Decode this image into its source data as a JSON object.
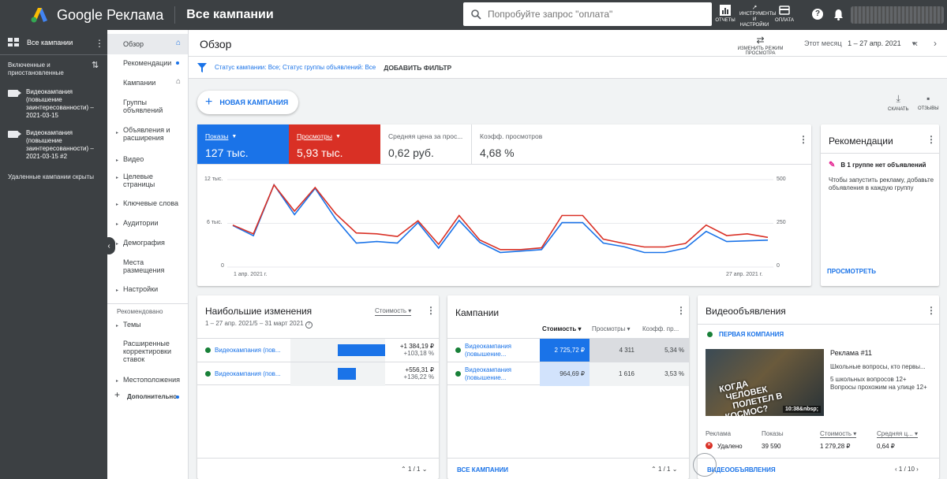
{
  "topbar": {
    "brand": "Google Реклама",
    "crumb": "Все кампании",
    "search_placeholder": "Попробуйте запрос \"оплата\"",
    "reports_label": "ОТЧЕТЫ",
    "tools_label": "ИНСТРУМЕНТЫ И НАСТРОЙКИ",
    "billing_label": "ОПЛАТА"
  },
  "camppanel": {
    "all_campaigns": "Все кампании",
    "filter_label": "Включенные и приостановленные",
    "campaigns": [
      {
        "name": "Видеокампания (повышение заинтересованности) – 2021-03-15"
      },
      {
        "name": "Видеокампания (повышение заинтересованности) – 2021-03-15 #2"
      }
    ],
    "hidden_label": "Удаленные кампании скрыты"
  },
  "nav": {
    "items": [
      {
        "label": "Обзор"
      },
      {
        "label": "Рекомендации"
      },
      {
        "label": "Кампании"
      },
      {
        "label": "Группы объявлений"
      },
      {
        "label": "Объявления и расширения"
      },
      {
        "label": "Видео"
      },
      {
        "label": "Целевые страницы"
      },
      {
        "label": "Ключевые слова"
      },
      {
        "label": "Аудитории"
      },
      {
        "label": "Демография"
      },
      {
        "label": "Места размещения"
      },
      {
        "label": "Настройки"
      },
      {
        "label": "Темы"
      },
      {
        "label": "Расширенные корректировки ставок"
      },
      {
        "label": "Местоположения"
      },
      {
        "label": "Дополнительно"
      }
    ],
    "recommended_section": "Рекомендовано"
  },
  "main": {
    "title": "Обзор",
    "view_mode": "ИЗМЕНИТЬ РЕЖИМ ПРОСМОТРА",
    "period_label": "Этот месяц",
    "period_value": "1 – 27 апр. 2021",
    "filter_prefix": "Статус кампании: ",
    "filter_val1": "Все",
    "filter_mid": "; Статус группы объявлений: ",
    "filter_val2": "Все",
    "add_filter": "ДОБАВИТЬ ФИЛЬТР",
    "new_campaign": "НОВАЯ КАМПАНИЯ",
    "download": "СКАЧАТЬ",
    "feedback": "ОТЗЫВЫ"
  },
  "metrics": [
    {
      "label": "Показы",
      "value": "127 тыс."
    },
    {
      "label": "Просмотры",
      "value": "5,93 тыс."
    },
    {
      "label": "Средняя цена за прос...",
      "value": "0,62 руб."
    },
    {
      "label": "Коэфф. просмотров",
      "value": "4,68 %"
    }
  ],
  "colors": {
    "impressions": "#1a73e8",
    "views": "#d93025"
  },
  "chart_data": {
    "type": "line",
    "x_labels": [
      "1 апр. 2021 г.",
      "27 апр. 2021 г."
    ],
    "left_axis_ticks": [
      "12 тыс.",
      "6 тыс.",
      "0"
    ],
    "right_axis_ticks": [
      "500",
      "250",
      "0"
    ],
    "ylim_left": [
      0,
      12000
    ],
    "ylim_right": [
      0,
      500
    ],
    "series": [
      {
        "name": "Показы",
        "axis": "left",
        "color": "#1a73e8",
        "values": [
          5700,
          4300,
          11300,
          7200,
          10800,
          6600,
          3300,
          3500,
          3300,
          6100,
          2600,
          6400,
          3400,
          2000,
          2200,
          2400,
          6100,
          6100,
          3300,
          2800,
          2000,
          2000,
          2600,
          4900,
          3500,
          3600,
          3700
        ]
      },
      {
        "name": "Просмотры",
        "axis": "right",
        "color": "#d93025",
        "values": [
          240,
          190,
          470,
          320,
          455,
          305,
          195,
          190,
          175,
          265,
          130,
          295,
          155,
          100,
          100,
          110,
          295,
          295,
          160,
          135,
          115,
          115,
          135,
          240,
          180,
          190,
          170
        ]
      }
    ]
  },
  "reco": {
    "title": "Рекомендации",
    "line": "В 1 группе нет объявлений",
    "text": "Чтобы запустить рекламу, добавьте объявления в каждую группу",
    "link": "ПРОСМОТРЕТЬ"
  },
  "changes": {
    "title": "Наибольшие изменения",
    "subtitle": "1 – 27 апр. 2021/5 – 31 март 2021",
    "metric": "Стоимость",
    "rows": [
      {
        "name": "Видеокампания (пов...",
        "value": "+1 384,19 ₽",
        "pct": "+103,18 %",
        "bar": 1.0
      },
      {
        "name": "Видеокампания (пов...",
        "value": "+556,31 ₽",
        "pct": "+136,22 %",
        "bar": 0.39
      }
    ],
    "pager": "1 / 1"
  },
  "campaigns": {
    "title": "Кампании",
    "cols": [
      "Стоимость",
      "Просмотры",
      "Коэфф. пр..."
    ],
    "rows": [
      {
        "name1": "Видеокампания",
        "name2": "(повышение...",
        "cost": "2 725,72 ₽",
        "views": "4 311",
        "rate": "5,34 %"
      },
      {
        "name1": "Видеокампания",
        "name2": "(повышение...",
        "cost": "964,69 ₽",
        "views": "1 616",
        "rate": "3,53 %"
      }
    ],
    "footer_link": "ВСЕ КАМПАНИИ",
    "pager": "1 / 1"
  },
  "videoads": {
    "title": "Видеообъявления",
    "campaign": "ПЕРВАЯ КОМПАНИЯ",
    "thumb_text1": "КОГДА",
    "thumb_text2": "ЧЕЛОВЕК",
    "thumb_text3": "ПОЛЕТЕЛ В КОСМОС?",
    "duration": "10:38&nbsp;",
    "ad_title": "Реклама #11",
    "ad_line1": "Школьные вопросы, кто первы...",
    "ad_line2": "5 школьных вопросов 12+",
    "ad_line3": "Вопросы прохожим на улице 12+",
    "cols": [
      "Реклама",
      "Показы",
      "Стоимость",
      "Средняя ц..."
    ],
    "status": "Удалено",
    "impr": "39 590",
    "cost": "1 279,28 ₽",
    "avg": "0,64 ₽",
    "footer_link": "ВИДЕООБЪЯВЛЕНИЯ",
    "pager": "1 / 10"
  }
}
